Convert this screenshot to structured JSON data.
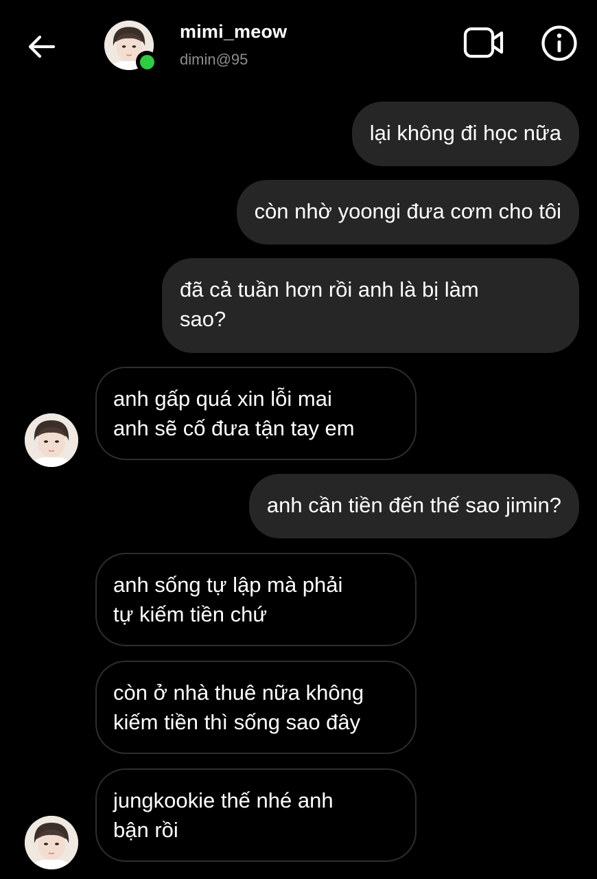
{
  "header": {
    "name": "mimi_meow",
    "handle": "dimin@95",
    "online_color": "#2ecc40"
  },
  "icons": {
    "back": "arrow-left-icon",
    "video": "video-camera-icon",
    "info": "info-circle-icon"
  },
  "messages": [
    {
      "sender": "me",
      "text": "lại không đi học nữa"
    },
    {
      "sender": "me",
      "text": "còn nhờ yoongi đưa cơm cho tôi"
    },
    {
      "sender": "me",
      "text": "đã cả tuần hơn rồi anh là bị làm\nsao?"
    },
    {
      "sender": "other",
      "text": "anh gấp quá xin lỗi mai\nanh sẽ cố đưa tận tay em"
    },
    {
      "sender": "me",
      "text": "anh cần tiền đến thế sao jimin?"
    },
    {
      "sender": "other",
      "text": "anh sống tự lập mà phải\ntự kiếm tiền chứ"
    },
    {
      "sender": "other",
      "text": "còn ở nhà thuê nữa không\nkiếm tiền thì sống sao đây"
    },
    {
      "sender": "other",
      "text": "jungkookie thế nhé anh\nbận rồi"
    }
  ],
  "colors": {
    "background": "#000000",
    "outgoing_bubble": "#262626",
    "incoming_border": "#2e2e2e",
    "handle_text": "#8e8e8e"
  }
}
